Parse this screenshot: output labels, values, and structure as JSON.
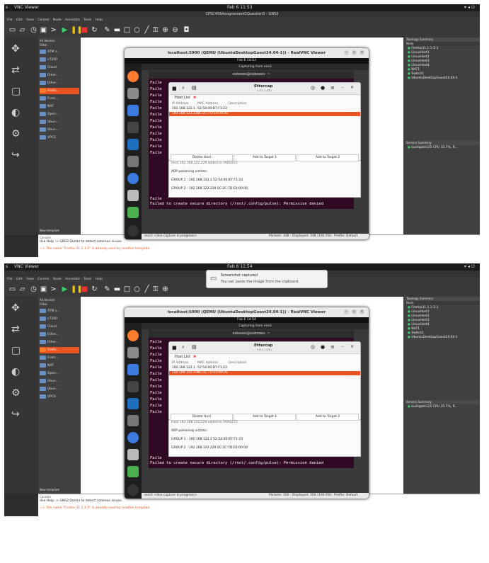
{
  "screens": [
    {
      "topbar": {
        "activities": "s",
        "app": "VNC Viewer",
        "clock": "Feb 6  11:53"
      },
      "gns_title": "CPSC456Assignement1Question5 - GNS3",
      "vnc_title": "localhost:5900 (QEMU (UbuntuDesktopGuest24.04-1)) - RealVNC Viewer",
      "guest_clock": "Feb 6  14:53",
      "wireshark_title": "Capturing from ens3",
      "notification": null
    },
    {
      "topbar": {
        "activities": "s",
        "app": "VNC Viewer",
        "clock": "Feb 6  11:54"
      },
      "gns_title": "CPSC456Assignement1Question5 - GNS3",
      "vnc_title": "localhost:5900 (QEMU (UbuntuDesktopGuest24.04-1)) - RealVNC Viewer",
      "guest_clock": "Feb 6  14:54",
      "wireshark_title": "Capturing from ens3",
      "notification": {
        "title": "Screenshot captured",
        "body": "You can paste the image from the clipboard."
      }
    }
  ],
  "menu": [
    "File",
    "Edit",
    "View",
    "Control",
    "Node",
    "Annotate",
    "Tools",
    "Help"
  ],
  "devices": {
    "header": "All devices",
    "filter": "Filter",
    "items": [
      "ATM s...",
      "c7200",
      "Cloud",
      "Ether...",
      "Ether...",
      "Firefo...",
      "Fram...",
      "NAT",
      "Open...",
      "Ubun...",
      "Ubun...",
      "VPCS"
    ],
    "new_template": "New template"
  },
  "topology": {
    "title": "Topology Summary",
    "col": "Node",
    "nodes": [
      "Firefox31.1.1-2-1",
      "LinuxHost1",
      "LinuxHost2",
      "LinuxHost3",
      "LinuxHost4",
      "NAT1",
      "Switch1",
      "UbuntuDesktopGuest24.04-1"
    ]
  },
  "servers": {
    "title": "Servers Summary",
    "item": "kushgate125 CPU 35.7%, R..."
  },
  "console": {
    "label": "Console",
    "line1": "Use Help -> GNS3 Doctor to detect common issues.",
    "line2": "=> The name \"Firefox 31.1.1-2\" is already used by another template"
  },
  "terminal": {
    "title": "osboxes@osboxes: ~",
    "lines": [
      "Faile",
      "Faile",
      "Faile",
      "Faile",
      "Faile",
      "Faile",
      "Faile",
      "Faile",
      "Faile",
      "Faile",
      "Faile",
      "Faile",
      "Faile",
      "Faile",
      "Faile"
    ],
    "bottom_line": "Failed to create secure directory (/root/.config/pulse): Permission denied"
  },
  "ettercap": {
    "title": "Ettercap",
    "version": "0.8.3.1 (EB)",
    "tab": "Host List",
    "cols": [
      "IP Address",
      "MAC Address",
      "Description"
    ],
    "hosts": [
      {
        "ip": "192.168.122.1",
        "mac": "52:54:00:B7:F1:23"
      },
      {
        "ip": "192.168.122.229",
        "mac": "0C:2C:7D:E0:00:00"
      }
    ],
    "buttons": [
      "Delete Host",
      "Add to Target 1",
      "Add to Target 2"
    ],
    "log": [
      "Host 192.168.122.229 added to TARGET2",
      "ARP poisoning victims:",
      "GROUP 1 : 192.168.122.1 52:54:00:B7:F1:23",
      "GROUP 2 : 192.168.122.229 0C:2C:7D:E0:00:00"
    ]
  },
  "status": {
    "capture": "ens3: <live capture in progress>",
    "packets": [
      "Packets: 348 · Displayed: 348 (100.0%)",
      "Packets: 356 · Displayed: 356 (100.0%)"
    ],
    "profile": "Profile: Default"
  },
  "colors": {
    "accent": "#e95420",
    "terminal_bg": "#300a24",
    "gns_bg": "#2c2c2c"
  }
}
